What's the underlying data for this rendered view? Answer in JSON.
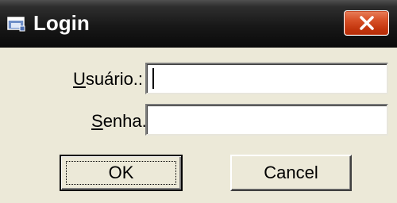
{
  "window": {
    "title": "Login",
    "title_icon": "app-window-icon",
    "close_icon": "close-x-icon",
    "colors": {
      "titlebar": "#1a1a1a",
      "close_button": "#d9532a",
      "dialog_background": "#ece9d8"
    }
  },
  "form": {
    "usuario": {
      "label_mnemonic": "U",
      "label_rest": "suário.:",
      "value": ""
    },
    "senha": {
      "label_mnemonic": "S",
      "label_rest": "enha.:",
      "value": ""
    }
  },
  "buttons": {
    "ok_label": "OK",
    "cancel_label": "Cancel"
  }
}
